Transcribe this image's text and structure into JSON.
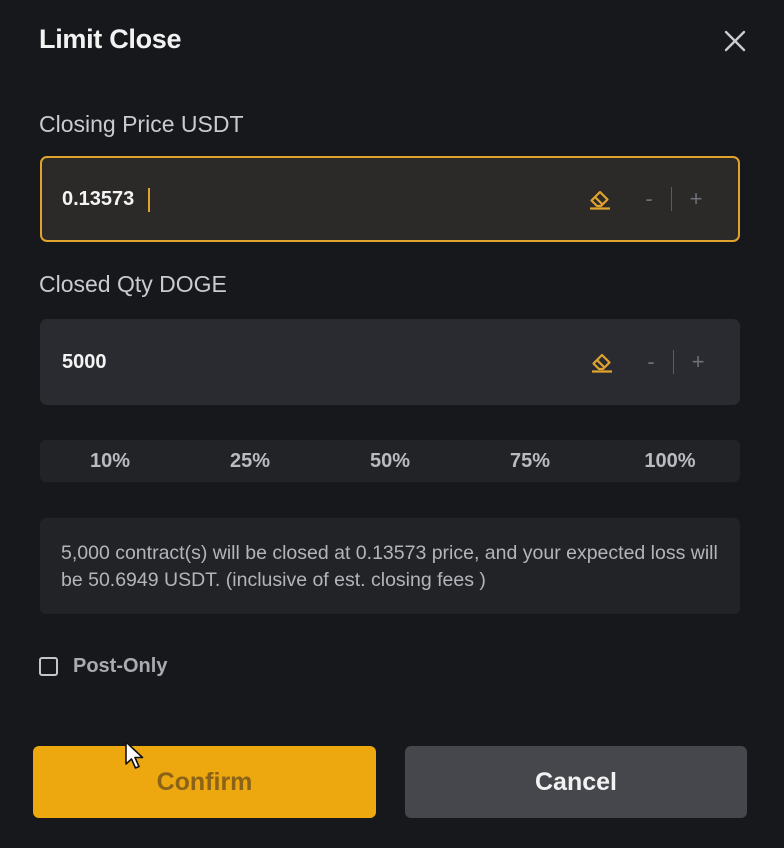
{
  "dialog": {
    "title": "Limit Close"
  },
  "price": {
    "label": "Closing Price USDT",
    "value": "0.13573",
    "minus": "-",
    "plus": "+"
  },
  "qty": {
    "label": "Closed Qty DOGE",
    "value": "5000",
    "minus": "-",
    "plus": "+"
  },
  "percentages": [
    "10%",
    "25%",
    "50%",
    "75%",
    "100%"
  ],
  "info": {
    "text": "5,000 contract(s) will be closed at 0.13573 price, and your expected loss will be 50.6949 USDT. (inclusive of est. closing fees )"
  },
  "post_only": {
    "label": "Post-Only",
    "checked": false
  },
  "buttons": {
    "confirm": "Confirm",
    "cancel": "Cancel"
  },
  "colors": {
    "accent": "#eda80f",
    "focus_border": "#e0a32e",
    "background": "#17181c",
    "field": "#2a2b30"
  },
  "icons": {
    "close": "close-icon",
    "eraser": "eraser-icon",
    "cursor": "mouse-pointer-icon"
  }
}
